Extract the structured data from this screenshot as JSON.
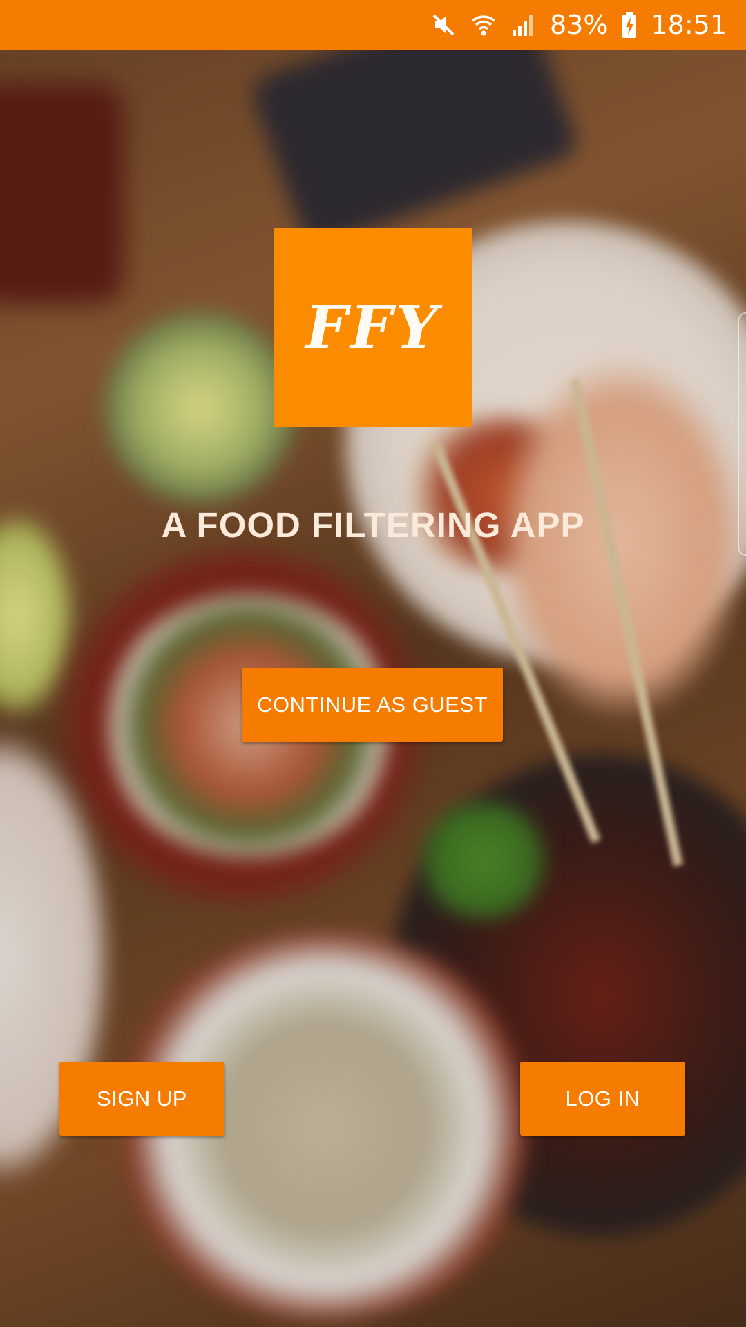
{
  "status_bar": {
    "battery": "83%",
    "time": "18:51",
    "icons": [
      "mute-icon",
      "wifi-icon",
      "signal-icon",
      "battery-charging-icon"
    ]
  },
  "logo": {
    "text": "FFY"
  },
  "tagline": "A FOOD FILTERING APP",
  "buttons": {
    "guest": "CONTINUE AS GUEST",
    "signup": "SIGN UP",
    "login": "LOG IN"
  },
  "colors": {
    "primary": "#f57c00",
    "logo_bg": "#fb8c00",
    "tagline": "#fbe9d9"
  }
}
